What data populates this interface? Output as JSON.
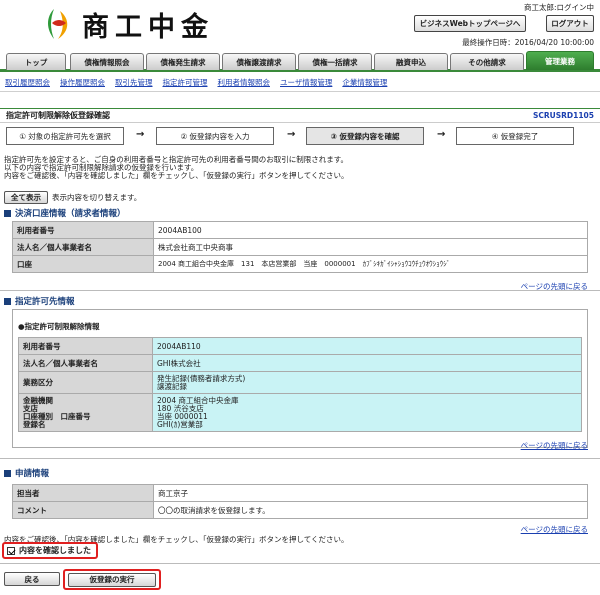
{
  "header": {
    "logo_text": "商工中金",
    "user_status": "商工太郎:ログイン中",
    "top_page_button": "ビジネスWebトップページへ",
    "logout_button": "ログアウト",
    "last_operation": "最終操作日時：2016/04/20 10:00:00"
  },
  "tabs": [
    "トップ",
    "債権情報照会",
    "債権発生請求",
    "債権譲渡請求",
    "債権一括請求",
    "融資申込",
    "その他請求",
    "管理業務"
  ],
  "subnav": [
    "取引履歴照会",
    "操作履歴照会",
    "取引先管理",
    "指定許可管理",
    "利用者情報照会",
    "ユーザ情報管理",
    "企業情報管理"
  ],
  "page": {
    "title": "指定許可制限解除仮登録確認",
    "screen_id": "SCRUSRD1105"
  },
  "steps": [
    "① 対象の指定許可先を選択",
    "② 仮登録内容を入力",
    "③ 仮登録内容を確認",
    "④ 仮登録完了"
  ],
  "intro": [
    "指定許可先を設定すると、ご自身の利用者番号と指定許可先の利用者番号間のお取引に制限されます。",
    "以下の内容で指定許可制限解除請求の仮登録を行います。",
    "内容をご確認後、「内容を確認しました」欄をチェックし、「仮登録の実行」ボタンを押してください。"
  ],
  "show_all": {
    "button": "全て表示",
    "note": "表示内容を切り替えます。"
  },
  "settlement": {
    "heading": "決済口座情報（請求者情報）",
    "rows": [
      {
        "key": "利用者番号",
        "value": "2004AB100"
      },
      {
        "key": "法人名／個人事業者名",
        "value": "株式会社商工中央商事"
      },
      {
        "key": "口座",
        "value": "2004 商工組合中央金庫　131　本店営業部　当座　0000001　ｶﾌﾞｼｷｶﾞｲｼｬｼｮｳｺｳﾁｭｳｵｳｼｮｳｼﾞ"
      }
    ]
  },
  "back_to_top": "ページの先頭に戻る",
  "permitted": {
    "heading": "指定許可先情報",
    "sub_heading": "●指定許可制限解除情報",
    "user_no_key": "利用者番号",
    "user_no": "2004AB110",
    "name_key": "法人名／個人事業者名",
    "name": "GHI株式会社",
    "business_key": "業務区分",
    "business_1": "発生記録(債務者請求方式)",
    "business_2": "譲渡記録",
    "bank_key_1": "金融機関",
    "bank_key_2": "支店",
    "bank_key_3": "口座種別　口座番号",
    "bank_key_4": "登録名",
    "bank_val_1": "2004 商工組合中央金庫",
    "bank_val_2": "180 渋谷支店",
    "bank_val_3": "当座 0000011",
    "bank_val_4": "GHI(ｶ)営業部"
  },
  "application": {
    "heading": "申請情報",
    "rows": [
      {
        "key": "担当者",
        "value": "商工京子"
      },
      {
        "key": "コメント",
        "value": "〇〇の取消請求を仮登録します。"
      }
    ]
  },
  "confirm": {
    "note": "内容をご確認後、「内容を確認しました」欄をチェックし、「仮登録の実行」ボタンを押してください。",
    "checkbox_label": "内容を確認しました"
  },
  "buttons": {
    "back": "戻る",
    "execute": "仮登録の実行"
  },
  "colors": {
    "accent_green": "#2e7d2e",
    "link_blue": "#1a3fb0",
    "section_navy": "#1a3f7a",
    "highlight_red": "#e02020",
    "value_cyan": "#c9f3f5"
  }
}
